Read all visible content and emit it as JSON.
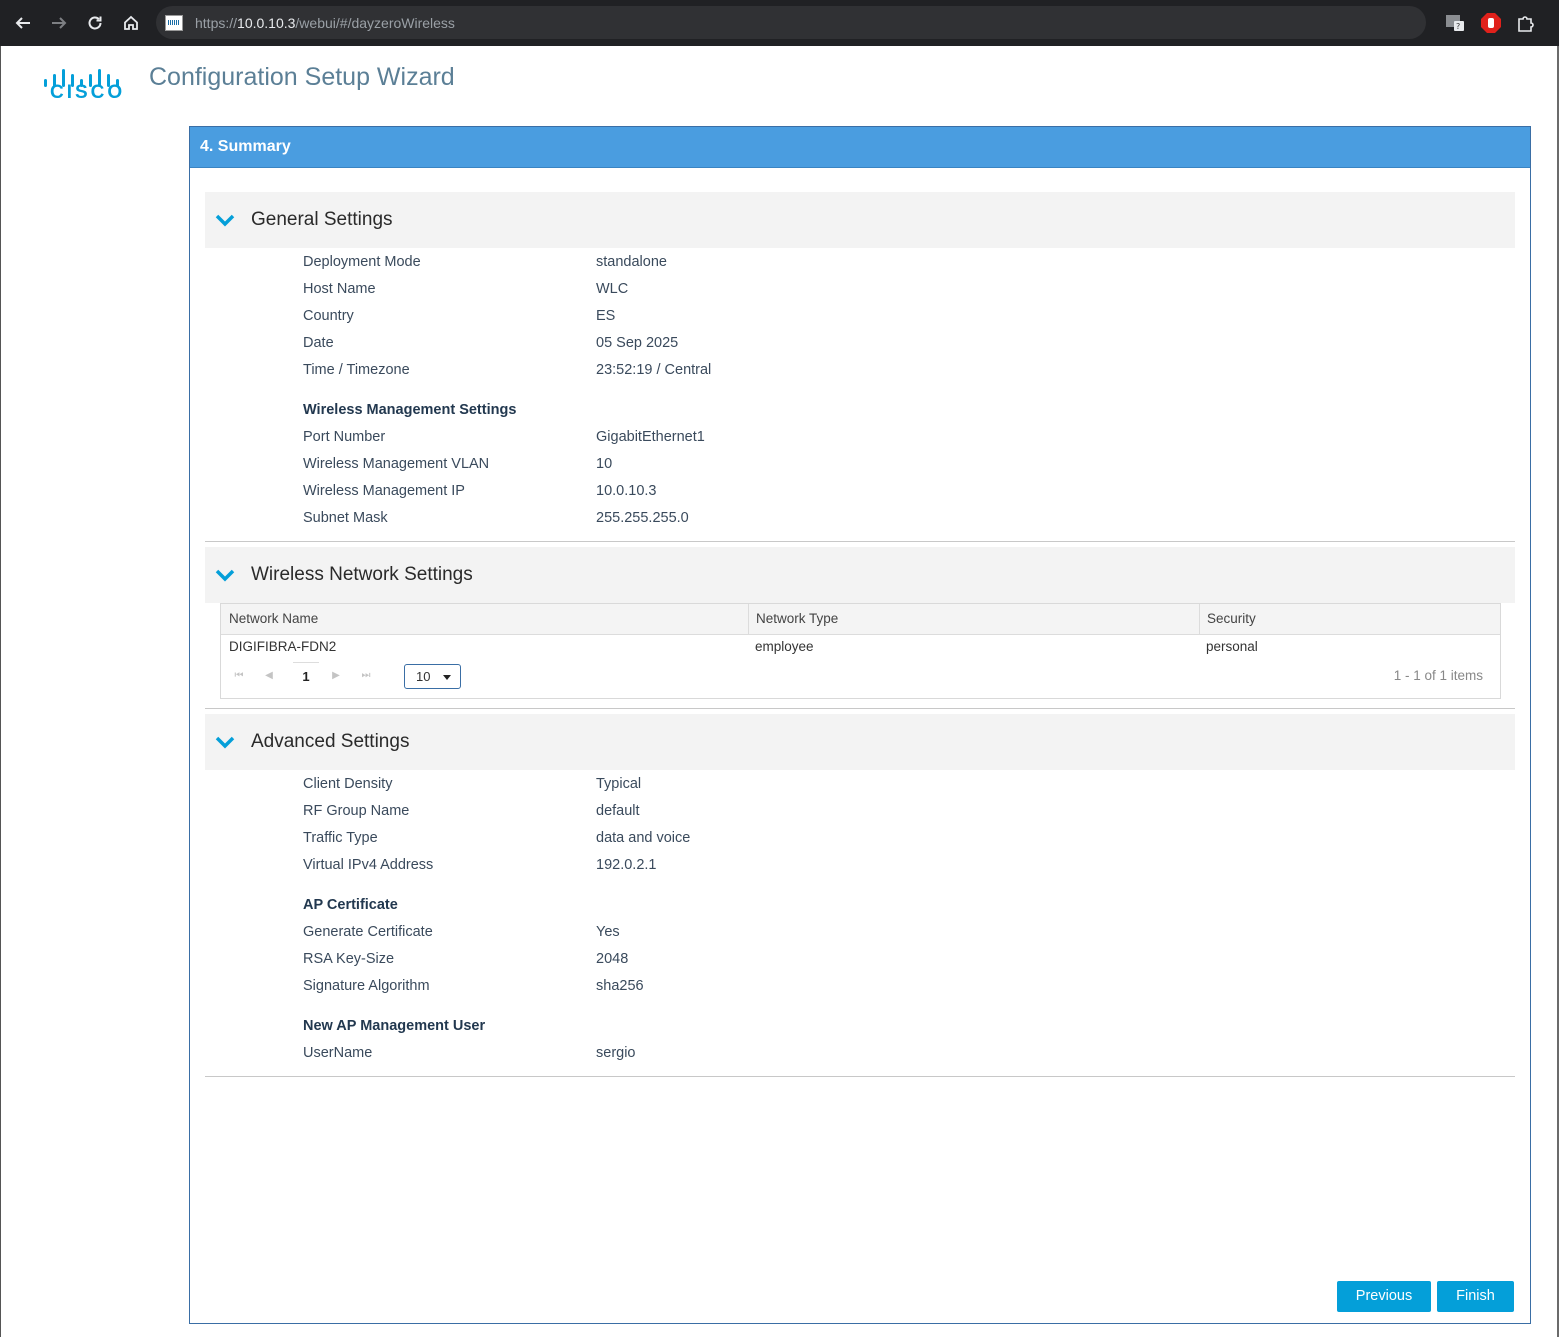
{
  "browser": {
    "url_scheme": "https://",
    "url_host": "10.0.10.3",
    "url_path": "/webui/#/dayzeroWireless"
  },
  "header": {
    "logo_text": "CISCO",
    "title": "Configuration Setup Wizard"
  },
  "panel": {
    "title": "4. Summary"
  },
  "general": {
    "title": "General Settings",
    "rows": [
      {
        "label": "Deployment Mode",
        "value": "standalone"
      },
      {
        "label": "Host Name",
        "value": "WLC"
      },
      {
        "label": "Country",
        "value": "ES"
      },
      {
        "label": "Date",
        "value": "05 Sep 2025"
      },
      {
        "label": "Time / Timezone",
        "value": "23:52:19 / Central"
      }
    ],
    "mgmt_title": "Wireless Management Settings",
    "mgmt_rows": [
      {
        "label": "Port Number",
        "value": "GigabitEthernet1"
      },
      {
        "label": "Wireless Management VLAN",
        "value": "10"
      },
      {
        "label": "Wireless Management IP",
        "value": "10.0.10.3"
      },
      {
        "label": "Subnet Mask",
        "value": "255.255.255.0"
      }
    ]
  },
  "wireless": {
    "title": "Wireless Network Settings",
    "columns": [
      "Network Name",
      "Network Type",
      "Security"
    ],
    "rows": [
      [
        "DIGIFIBRA-FDN2",
        "employee",
        "personal"
      ]
    ],
    "pager": {
      "current_page": "1",
      "page_size": "10",
      "items_info": "1 - 1 of 1 items"
    }
  },
  "advanced": {
    "title": "Advanced Settings",
    "rows": [
      {
        "label": "Client Density",
        "value": "Typical"
      },
      {
        "label": "RF Group Name",
        "value": "default"
      },
      {
        "label": "Traffic Type",
        "value": "data and voice"
      },
      {
        "label": "Virtual IPv4 Address",
        "value": "192.0.2.1"
      }
    ],
    "cert_title": "AP Certificate",
    "cert_rows": [
      {
        "label": "Generate Certificate",
        "value": "Yes"
      },
      {
        "label": "RSA Key-Size",
        "value": "2048"
      },
      {
        "label": "Signature Algorithm",
        "value": "sha256"
      }
    ],
    "user_title": "New AP Management User",
    "user_rows": [
      {
        "label": "UserName",
        "value": "sergio"
      }
    ]
  },
  "buttons": {
    "previous": "Previous",
    "finish": "Finish"
  },
  "colors": {
    "panel_header": "#4a9de0",
    "button": "#049fd9",
    "chevron": "#049fd9"
  }
}
